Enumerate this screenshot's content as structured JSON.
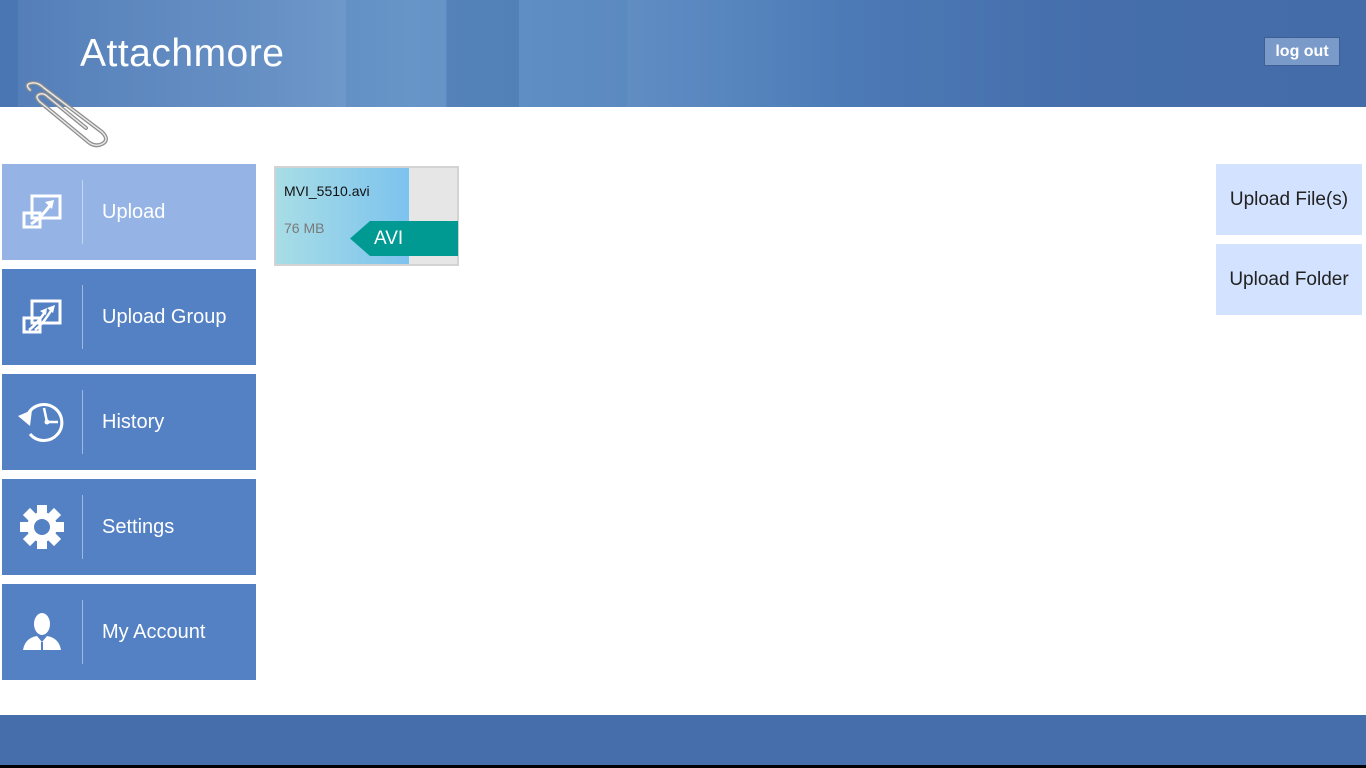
{
  "header": {
    "app_title": "Attachmore",
    "logout_label": "log out"
  },
  "sidebar": {
    "items": [
      {
        "label": "Upload",
        "icon": "upload-icon",
        "active": true
      },
      {
        "label": "Upload Group",
        "icon": "upload-group-icon",
        "active": false
      },
      {
        "label": "History",
        "icon": "history-icon",
        "active": false
      },
      {
        "label": "Settings",
        "icon": "gear-icon",
        "active": false
      },
      {
        "label": "My Account",
        "icon": "user-icon",
        "active": false
      }
    ]
  },
  "files": [
    {
      "name": "MVI_5510.avi",
      "size": "76 MB",
      "type": "AVI"
    }
  ],
  "actions": {
    "upload_files_label": "Upload File(s)",
    "upload_folder_label": "Upload Folder"
  },
  "colors": {
    "nav": "#5480c4",
    "nav_active": "#95b4e5",
    "action_button": "#d2e2ff",
    "file_tag": "#009a93",
    "header": "#456eab"
  }
}
